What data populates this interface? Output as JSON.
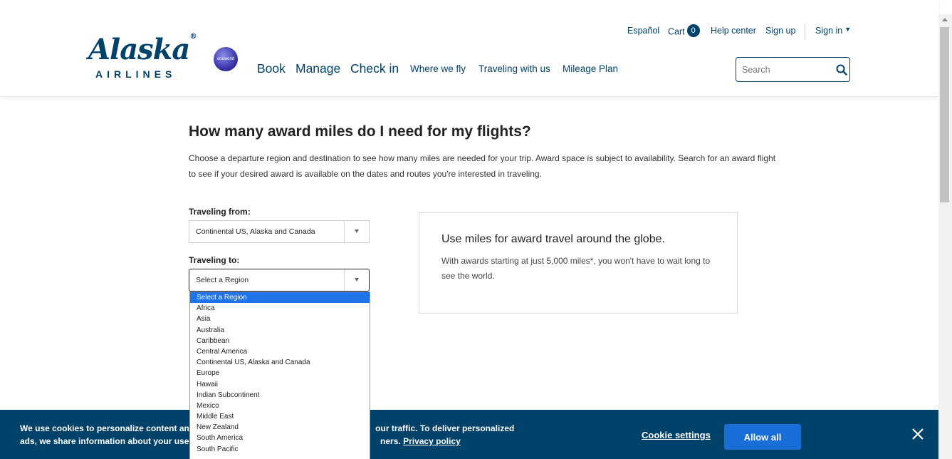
{
  "header": {
    "logo": {
      "wordmark": "Alaska",
      "registered": "®",
      "subtitle": "AIRLINES"
    },
    "oneworld_label": "oneworld",
    "utility": {
      "espanol": "Español",
      "cart": "Cart",
      "cart_count": "0",
      "help": "Help center",
      "signup": "Sign up",
      "signin": "Sign in"
    },
    "nav": {
      "book": "Book",
      "manage": "Manage",
      "checkin": "Check in",
      "where": "Where we fly",
      "traveling": "Traveling with us",
      "mileage": "Mileage Plan"
    },
    "search": {
      "placeholder": "Search"
    }
  },
  "main": {
    "title": "How many award miles do I need for my flights?",
    "intro": "Choose a departure region and destination to see how many miles are needed for your trip. Award space is subject to availability. Search for an award flight to see if your desired award is available on the dates and routes you're interested in traveling.",
    "from_label": "Traveling from:",
    "from_value": "Continental US, Alaska and Canada",
    "to_label": "Traveling to:",
    "to_value": "Select a Region",
    "dropdown_options": [
      "Select a Region",
      "Africa",
      "Asia",
      "Australia",
      "Caribbean",
      "Central America",
      "Continental US, Alaska and Canada",
      "Europe",
      "Hawaii",
      "Indian Subcontinent",
      "Mexico",
      "Middle East",
      "New Zealand",
      "South America",
      "South Pacific"
    ],
    "promo": {
      "title": "Use miles for award travel around the globe.",
      "text": "With awards starting at just 5,000 miles*, you won't have to wait long to see the world."
    }
  },
  "cookie": {
    "line1_start": "We use cookies to personalize content and",
    "line1_end": "our traffic. To deliver personalized",
    "line2_start": "ads, we share information about your use of",
    "line2_end": "ners.",
    "privacy_link": "Privacy policy",
    "settings": "Cookie settings",
    "allow": "Allow all"
  },
  "colors": {
    "brand": "#01426a",
    "accent": "#1a6ed8",
    "selected": "#1e74e8"
  },
  "icons": [
    "search-icon",
    "close-icon",
    "chevron-down-icon",
    "oneworld-logo"
  ]
}
